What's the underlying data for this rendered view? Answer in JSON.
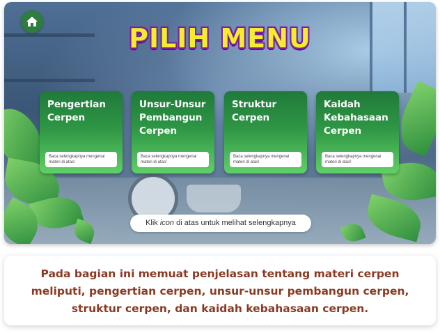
{
  "header": {
    "title": "PILIH MENU",
    "home_icon": "home-icon"
  },
  "menu": {
    "cards": [
      {
        "title_lines": [
          "Pengertian",
          "Cerpen"
        ],
        "note": "Baca selengkapnya mengenai materi di atas!"
      },
      {
        "title_lines": [
          "Unsur-Unsur",
          "Pembangun",
          "Cerpen"
        ],
        "note": "Baca selengkapnya mengenai materi di atas!"
      },
      {
        "title_lines": [
          "Struktur",
          "Cerpen"
        ],
        "note": "Baca selengkapnya mengenai materi di atas!"
      },
      {
        "title_lines": [
          "Kaidah",
          "Kebahasaan",
          "Cerpen"
        ],
        "note": "Baca selengkapnya mengenai materi di atas!"
      }
    ]
  },
  "hint": {
    "before": "Klik ",
    "emphasis": "icon",
    "after": " di atas untuk melihat selengkapnya"
  },
  "caption": {
    "text": "Pada bagian ini memuat penjelasan tentang materi cerpen meliputi, pengertian cerpen, unsur-unsur pembangun cerpen, struktur cerpen, dan kaidah kebahasaan cerpen."
  },
  "colors": {
    "card_top": "#1f7a3a",
    "card_bottom": "#5fd066",
    "title_fill": "#f4ec2c",
    "title_outline": "#7a1fa0",
    "caption_text": "#8a3a22"
  }
}
